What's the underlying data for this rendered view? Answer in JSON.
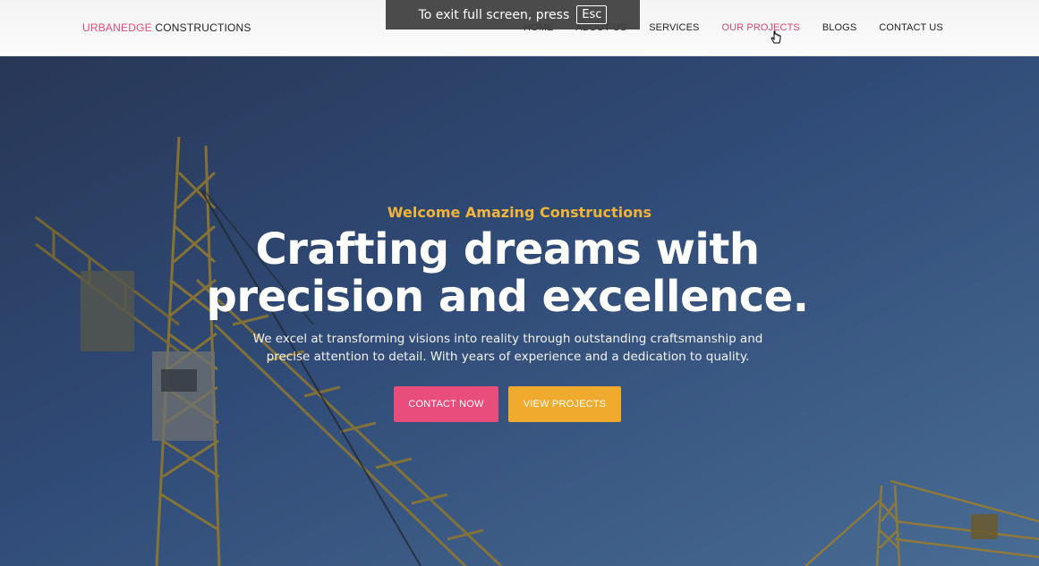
{
  "toast": {
    "message": "To exit full screen, press",
    "key": "Esc"
  },
  "brand": {
    "accent": "URBANEDGE",
    "rest": " CONSTRUCTIONS"
  },
  "nav": {
    "items": [
      {
        "label": "HOME"
      },
      {
        "label": "ABOUT US"
      },
      {
        "label": "SERVICES"
      },
      {
        "label": "OUR PROJECTS"
      },
      {
        "label": "BLOGS"
      },
      {
        "label": "CONTACT US"
      }
    ],
    "active_index": 3
  },
  "hero": {
    "eyebrow": "Welcome Amazing Constructions",
    "headline_line1": "Crafting dreams with",
    "headline_line2": "precision and excellence.",
    "subtext": "We excel at transforming visions into reality through outstanding craftsmanship and precise attention to detail. With years of experience and a dedication to quality.",
    "contact_button": "CONTACT NOW",
    "projects_button": "VIEW PROJECTS"
  },
  "colors": {
    "accent_pink": "#e84d7c",
    "accent_orange": "#f0aa2e",
    "eyebrow_gold": "#f0b43a"
  }
}
